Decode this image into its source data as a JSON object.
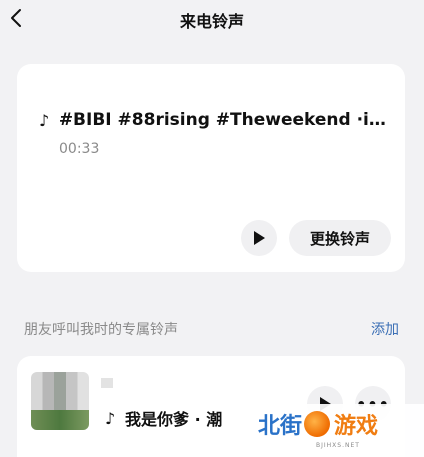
{
  "header": {
    "title": "来电铃声",
    "back_icon": "chevron-left-icon"
  },
  "current_ringtone": {
    "note_glyph": "♪",
    "title": "#BIBI #88rising #Theweekend ·im…",
    "duration": "00:33",
    "play_icon": "play-icon",
    "change_label": "更换铃声"
  },
  "contacts_section": {
    "label": "朋友呼叫我时的专属铃声",
    "add_label": "添加"
  },
  "contact_item": {
    "note_glyph": "♪",
    "ringtone": "我是你爹 · 潮",
    "play_icon": "play-icon",
    "more_label": "•••"
  },
  "watermark": {
    "text_blue": "北街",
    "text_orange": "游戏",
    "subtext": "BJIHXS.NET"
  },
  "colors": {
    "background": "#f2f2f4",
    "card": "#ffffff",
    "link_blue": "#3b6fb5",
    "muted": "#8a8a8a"
  }
}
